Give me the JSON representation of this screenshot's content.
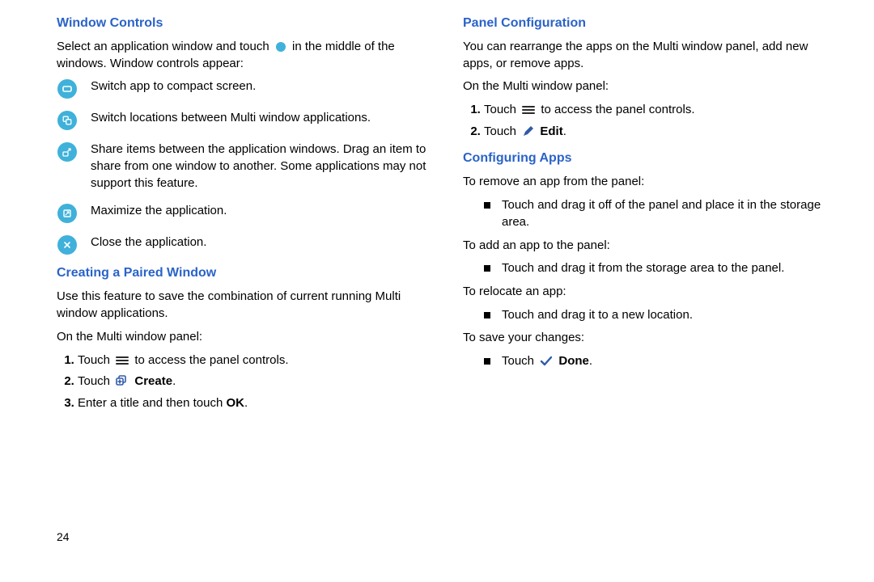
{
  "left": {
    "wc_heading": "Window Controls",
    "wc_intro_a": "Select an application window and touch",
    "wc_intro_b": "in the middle of the windows. Window controls appear:",
    "wc_items": [
      "Switch app to compact screen.",
      "Switch locations between Multi window applications.",
      "Share items between the application windows. Drag an item to share from one window to another. Some applications may not support this feature.",
      "Maximize the application.",
      "Close the application."
    ],
    "cpw_heading": "Creating a Paired Window",
    "cpw_intro": "Use this feature to save the combination of current running Multi window applications.",
    "cpw_on": "On the Multi window panel:",
    "cpw_step1_a": "Touch",
    "cpw_step1_b": "to access the panel controls.",
    "cpw_step2_a": "Touch",
    "cpw_step2_b": "Create",
    "cpw_step2_c": ".",
    "cpw_step3_a": "Enter a title and then touch ",
    "cpw_step3_b": "OK",
    "cpw_step3_c": "."
  },
  "right": {
    "pc_heading": "Panel Configuration",
    "pc_intro": "You can rearrange the apps on the Multi window panel, add new apps, or remove apps.",
    "pc_on": "On the Multi window panel:",
    "pc_step1_a": "Touch",
    "pc_step1_b": "to access the panel controls.",
    "pc_step2_a": "Touch",
    "pc_step2_b": "Edit",
    "pc_step2_c": ".",
    "ca_heading": "Configuring Apps",
    "ca_remove_label": "To remove an app from the panel:",
    "ca_remove_item": "Touch and drag it off of the panel and place it in the storage area.",
    "ca_add_label": "To add an app to the panel:",
    "ca_add_item": "Touch and drag it from the storage area to the panel.",
    "ca_relocate_label": "To relocate an app:",
    "ca_relocate_item": "Touch and drag it to a new location.",
    "ca_save_label": "To save your changes:",
    "ca_save_item_a": "Touch",
    "ca_save_item_b": "Done",
    "ca_save_item_c": "."
  },
  "page_number": "24"
}
